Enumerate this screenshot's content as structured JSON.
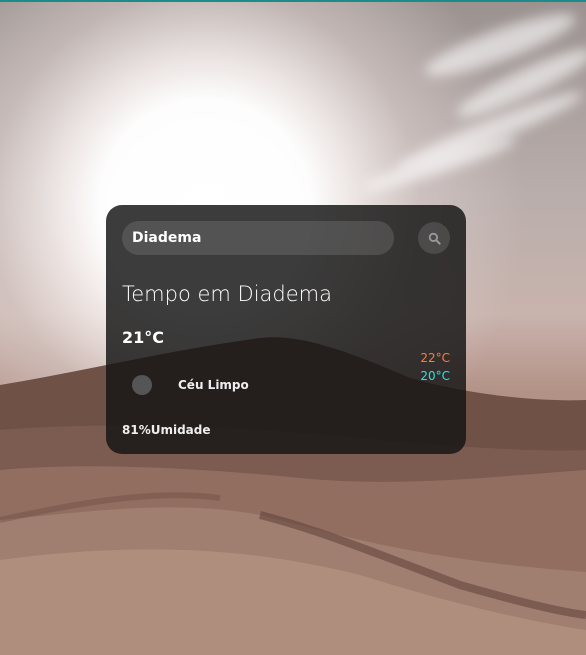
{
  "search": {
    "value": "Diadema",
    "placeholder": ""
  },
  "search_icon": "magnifier-icon",
  "weather": {
    "title": "Tempo em Diadema",
    "temperature": "21°C",
    "temp_max": "22°C",
    "temp_min": "20°C",
    "description": "Céu Limpo",
    "humidity": "81%Umidade",
    "icon": "weather-icon"
  },
  "colors": {
    "max_temp": "#ff7a3d",
    "min_temp": "#29e3e0",
    "card_bg": "rgba(20,20,20,0.83)"
  }
}
